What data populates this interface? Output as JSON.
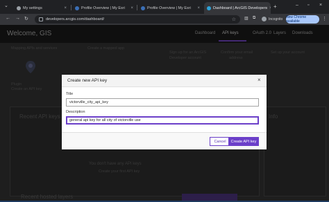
{
  "browser": {
    "tabs": [
      {
        "label": "My settings",
        "active": false
      },
      {
        "label": "Profile Overview | My Esri",
        "active": false
      },
      {
        "label": "Profile Overview | My Esri",
        "active": false
      },
      {
        "label": "Dashboard | ArcGIS Developers",
        "active": true
      }
    ],
    "url": "developers.arcgis.com/dashboard/",
    "incognito_label": "Incognito",
    "update_label": "New Chrome available"
  },
  "page": {
    "welcome": "Welcome, GIS",
    "nav": [
      "Dashboard",
      "API keys",
      "OAuth 2.0",
      "Layers",
      "Downloads"
    ],
    "active_nav": "API keys",
    "background_text": {
      "basemap_apis": "Mapping APIs and services",
      "create_map": "Create a mapped app",
      "signup": "Sign up for an ArcGIS",
      "signup2": "Developer account",
      "confirm": "Confirm your email",
      "confirm2": "address",
      "set_up": "Set up your account",
      "plugin": "Plugin",
      "create_api": "Create an API key",
      "recent": "Recent API keys",
      "no_keys": "You don't have any API keys",
      "create_link": "Create your first API key",
      "info": "Info",
      "recent_bottom": "Recent hosted layers"
    }
  },
  "modal": {
    "title": "Create new API key",
    "title_label": "Title",
    "title_value": "victorville_city_api_key",
    "description_label": "Description",
    "description_value": "general api key for all city of victorville use",
    "cancel_label": "Cancel",
    "create_label": "Create API key",
    "accent": "#6b3fc9"
  }
}
